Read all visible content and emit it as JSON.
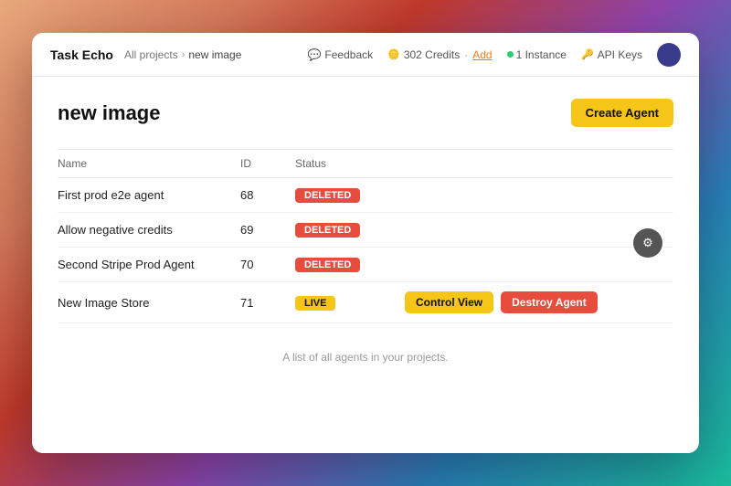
{
  "app": {
    "brand": "Task Echo",
    "breadcrumb": {
      "parent": "All projects",
      "separator": "›",
      "current": "new image"
    }
  },
  "nav": {
    "feedback_label": "Feedback",
    "credits_label": "302 Credits",
    "credits_add": "Add",
    "instance_label": "1 Instance",
    "api_label": "API Keys"
  },
  "page": {
    "title": "new image",
    "create_button": "Create Agent"
  },
  "table": {
    "columns": [
      "Name",
      "ID",
      "Status"
    ],
    "rows": [
      {
        "name": "First prod e2e agent",
        "id": "68",
        "status": "DELETED",
        "status_type": "deleted",
        "actions": []
      },
      {
        "name": "Allow negative credits",
        "id": "69",
        "status": "DELETED",
        "status_type": "deleted",
        "actions": []
      },
      {
        "name": "Second Stripe Prod Agent",
        "id": "70",
        "status": "DELETED",
        "status_type": "deleted",
        "actions": []
      },
      {
        "name": "New Image Store",
        "id": "71",
        "status": "LIVE",
        "status_type": "live",
        "actions": [
          "Control View",
          "Destroy Agent"
        ]
      }
    ],
    "empty_hint": "A list of all agents in your projects."
  },
  "actions": {
    "control_view": "Control View",
    "destroy_agent": "Destroy Agent"
  }
}
